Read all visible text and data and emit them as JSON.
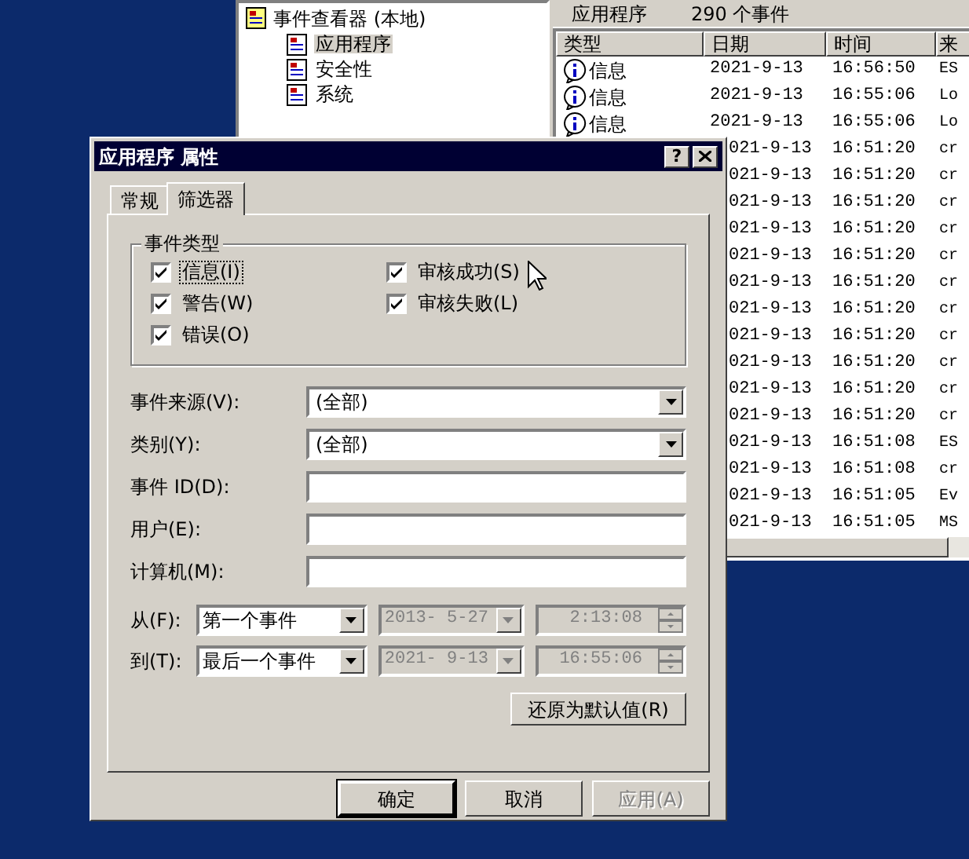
{
  "event_viewer": {
    "tree": {
      "label": "事件查看器 (本地)",
      "children": [
        {
          "label": "应用程序",
          "selected": true
        },
        {
          "label": "安全性",
          "selected": false
        },
        {
          "label": "系统",
          "selected": false
        }
      ]
    },
    "list_header": {
      "title": "应用程序",
      "count": "290 个事件"
    },
    "columns": [
      "类型",
      "日期",
      "时间",
      "来"
    ],
    "rows": [
      {
        "kind": "info",
        "type": "信息",
        "date": "2021-9-13",
        "time": "16:56:50",
        "source": "ES"
      },
      {
        "kind": "info",
        "type": "信息",
        "date": "2021-9-13",
        "time": "16:55:06",
        "source": "Lo"
      },
      {
        "kind": "info",
        "type": "信息",
        "date": "2021-9-13",
        "time": "16:55:06",
        "source": "Lo"
      },
      {
        "date": "021-9-13",
        "time": "16:51:20",
        "source": "cr"
      },
      {
        "date": "021-9-13",
        "time": "16:51:20",
        "source": "cr"
      },
      {
        "date": "021-9-13",
        "time": "16:51:20",
        "source": "cr"
      },
      {
        "date": "021-9-13",
        "time": "16:51:20",
        "source": "cr"
      },
      {
        "date": "021-9-13",
        "time": "16:51:20",
        "source": "cr"
      },
      {
        "date": "021-9-13",
        "time": "16:51:20",
        "source": "cr"
      },
      {
        "date": "021-9-13",
        "time": "16:51:20",
        "source": "cr"
      },
      {
        "date": "021-9-13",
        "time": "16:51:20",
        "source": "cr"
      },
      {
        "date": "021-9-13",
        "time": "16:51:20",
        "source": "cr"
      },
      {
        "date": "021-9-13",
        "time": "16:51:20",
        "source": "cr"
      },
      {
        "date": "021-9-13",
        "time": "16:51:20",
        "source": "cr"
      },
      {
        "date": "021-9-13",
        "time": "16:51:08",
        "source": "ES"
      },
      {
        "date": "021-9-13",
        "time": "16:51:08",
        "source": "cr"
      },
      {
        "date": "021-9-13",
        "time": "16:51:05",
        "source": "Ev"
      },
      {
        "date": "021-9-13",
        "time": "16:51:05",
        "source": "MS"
      }
    ]
  },
  "dialog": {
    "title": "应用程序 属性",
    "help_button": "?",
    "tabs": [
      {
        "label": "常规",
        "selected": false
      },
      {
        "label": "筛选器",
        "selected": true
      }
    ],
    "event_types": {
      "title": "事件类型",
      "options": [
        {
          "label": "信息(I)",
          "checked": true,
          "focused": true
        },
        {
          "label": "审核成功(S)",
          "checked": true,
          "focused": false
        },
        {
          "label": "警告(W)",
          "checked": true,
          "focused": false
        },
        {
          "label": "审核失败(L)",
          "checked": true,
          "focused": false
        },
        {
          "label": "错误(O)",
          "checked": true,
          "focused": false
        }
      ]
    },
    "fields": [
      {
        "kind": "dropdown",
        "label": "事件来源(V):",
        "value": "(全部)"
      },
      {
        "kind": "dropdown",
        "label": "类别(Y):",
        "value": "(全部)"
      },
      {
        "kind": "text",
        "label": "事件 ID(D):"
      },
      {
        "kind": "text",
        "label": "用户(E):"
      },
      {
        "kind": "text",
        "label": "计算机(M):"
      }
    ],
    "range": [
      {
        "label": "从(F):",
        "mode": "第一个事件",
        "date": "2013- 5-27",
        "time": "2:13:08",
        "disabled": true
      },
      {
        "label": "到(T):",
        "mode": "最后一个事件",
        "date": "2021- 9-13",
        "time": "16:55:06",
        "disabled": true
      }
    ],
    "restore_button": "还原为默认值(R)",
    "buttons": [
      {
        "label": "确定",
        "default": true,
        "disabled": false
      },
      {
        "label": "取消",
        "default": false,
        "disabled": false
      },
      {
        "label": "应用(A)",
        "default": false,
        "disabled": true
      }
    ]
  }
}
